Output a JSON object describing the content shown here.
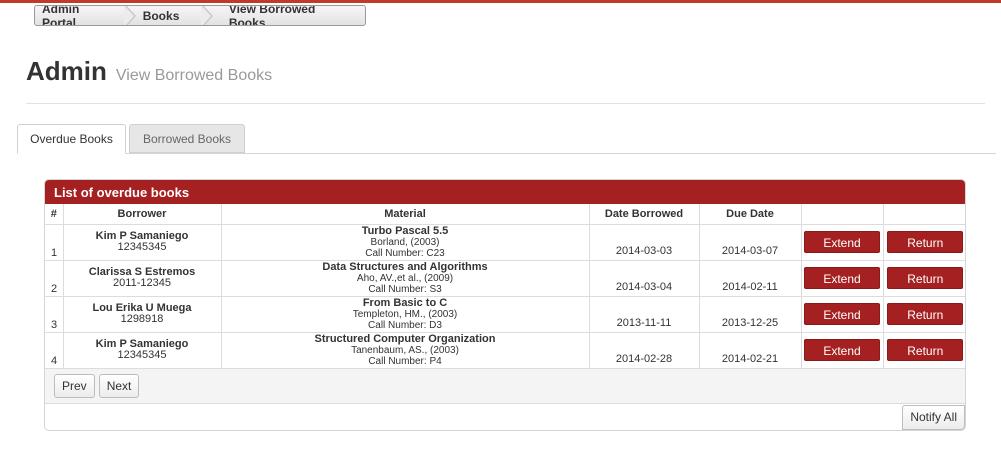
{
  "breadcrumb": {
    "items": [
      {
        "label": "Admin Portal"
      },
      {
        "label": "Books"
      },
      {
        "label": "View Borrowed Books"
      }
    ]
  },
  "header": {
    "title": "Admin",
    "subtitle": "View Borrowed Books"
  },
  "tabs": [
    {
      "label": "Overdue Books",
      "active": true
    },
    {
      "label": "Borrowed Books",
      "active": false
    }
  ],
  "panel": {
    "heading": "List of overdue books",
    "columns": [
      "#",
      "Borrower",
      "Material",
      "Date Borrowed",
      "Due Date",
      "",
      ""
    ],
    "rows": [
      {
        "num": "1",
        "borrower_name": "Kim P Samaniego",
        "borrower_id": "12345345",
        "title": "Turbo Pascal 5.5",
        "author": "Borland, (2003)",
        "call_number": "Call Number: C23",
        "date_borrowed": "2014-03-03",
        "due_date": "2014-03-07",
        "extend_label": "Extend",
        "return_label": "Return"
      },
      {
        "num": "2",
        "borrower_name": "Clarissa S Estremos",
        "borrower_id": "2011-12345",
        "title": "Data Structures and Algorithms",
        "author": "Aho, AV.,et al., (2009)",
        "call_number": "Call Number: S3",
        "date_borrowed": "2014-03-04",
        "due_date": "2014-02-11",
        "extend_label": "Extend",
        "return_label": "Return"
      },
      {
        "num": "3",
        "borrower_name": "Lou Erika U Muega",
        "borrower_id": "1298918",
        "title": "From Basic to C",
        "author": "Templeton, HM., (2003)",
        "call_number": "Call Number: D3",
        "date_borrowed": "2013-11-11",
        "due_date": "2013-12-25",
        "extend_label": "Extend",
        "return_label": "Return"
      },
      {
        "num": "4",
        "borrower_name": "Kim P Samaniego",
        "borrower_id": "12345345",
        "title": "Structured Computer Organization",
        "author": "Tanenbaum, AS., (2003)",
        "call_number": "Call Number: P4",
        "date_borrowed": "2014-02-28",
        "due_date": "2014-02-21",
        "extend_label": "Extend",
        "return_label": "Return"
      }
    ],
    "pager": {
      "prev_label": "Prev",
      "next_label": "Next"
    },
    "notify_label": "Notify All"
  },
  "colors": {
    "accent": "#a52020",
    "topline": "#c0392b"
  }
}
